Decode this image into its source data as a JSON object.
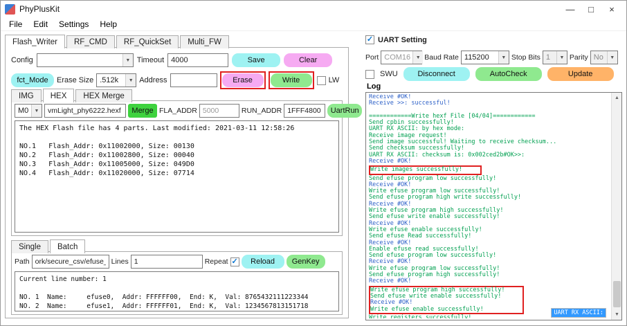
{
  "window": {
    "title": "PhyPlusKit",
    "controls": {
      "minimize": "—",
      "maximize": "□",
      "close": "×"
    }
  },
  "menu": {
    "items": [
      "File",
      "Edit",
      "Settings",
      "Help"
    ]
  },
  "main_tabs": [
    {
      "label": "Flash_Writer",
      "active": true
    },
    {
      "label": "RF_CMD",
      "active": false
    },
    {
      "label": "RF_QuickSet",
      "active": false
    },
    {
      "label": "Multi_FW",
      "active": false
    }
  ],
  "colors": {
    "button_cyan": "#9ef2f2",
    "button_pink": "#f6aaf2",
    "button_green": "#8fe98f",
    "button_green_dark": "#3ed23e",
    "button_orange": "#ffb368",
    "log_green": "#00a050",
    "log_blue": "#2b5fc7",
    "highlight_red": "#e02020",
    "selection_blue": "#3399ff"
  },
  "flash_writer": {
    "config_label": "Config",
    "config_value": "",
    "timeout_label": "Timeout",
    "timeout_value": "4000",
    "save_button": "Save",
    "clear_button": "Clear",
    "fct_mode_button": "fct_Mode",
    "erase_size_label": "Erase Size",
    "erase_size_value": ".512k",
    "address_label": "Address",
    "address_value": "",
    "erase_button": "Erase",
    "write_button": "Write",
    "lw_label": "LW",
    "lw_checked": false,
    "hex_tabs": [
      {
        "label": "IMG",
        "active": false
      },
      {
        "label": "HEX",
        "active": true
      },
      {
        "label": "HEX Merge",
        "active": false
      }
    ],
    "hex": {
      "mcu_value": "M0",
      "file_value": "vmLight_phy6222.hexf",
      "merge_button": "Merge",
      "fla_addr_label": "FLA_ADDR",
      "fla_addr_value": "5000",
      "run_addr_label": "RUN_ADDR",
      "run_addr_value": "1FFF4800",
      "uartrun_button": "UartRun",
      "info_lines": [
        "The HEX Flash file has 4 parts. Last modified: 2021-03-11 12:58:26",
        "",
        "NO.1   Flash_Addr: 0x11002000, Size: 00130",
        "NO.2   Flash_Addr: 0x11002800, Size: 00040",
        "NO.3   Flash_Addr: 0x11005000, Size: 049D0",
        "NO.4   Flash_Addr: 0x11020000, Size: 07714"
      ]
    },
    "batch_tabs": [
      {
        "label": "Single",
        "active": false
      },
      {
        "label": "Batch",
        "active": true
      }
    ],
    "batch": {
      "path_label": "Path",
      "path_value": "ork/secure_csv/efuse_wr.csv",
      "lines_label": "Lines",
      "lines_value": "1",
      "repeat_label": "Repeat",
      "repeat_checked": true,
      "reload_button": "Reload",
      "genkey_button": "GenKey",
      "info_lines": [
        "Current line number: 1",
        "",
        "NO. 1  Name:     efuse0,  Addr: FFFFFF00,  End: K,  Val: 8765432111223344",
        "NO. 2  Name:     efuse1,  Addr: FFFFFF01,  End: K,  Val: 1234567813151718"
      ]
    }
  },
  "uart": {
    "setting_label": "UART Setting",
    "setting_checked": true,
    "port_label": "Port",
    "port_value": "COM16",
    "baud_label": "Baud Rate",
    "baud_value": "115200",
    "stop_bits_label": "Stop Bits",
    "stop_bits_value": "1",
    "parity_label": "Parity",
    "parity_value": "No",
    "swu_label": "SWU",
    "swu_checked": false,
    "disconnect_button": "Disconnect",
    "autocheck_button": "AutoCheck",
    "update_button": "Update"
  },
  "log": {
    "label": "Log",
    "selection_text": "UART RX ASCII:",
    "segments": [
      {
        "boxed": false,
        "lines": [
          {
            "t": "Receive #OK!",
            "c": "b"
          },
          {
            "t": "Receive >>: successful!",
            "c": "b"
          },
          {
            "t": "",
            "c": "g"
          },
          {
            "t": "============Write hexf File [04/04]============",
            "c": "g"
          },
          {
            "t": "Send cpbin successfully!",
            "c": "g"
          },
          {
            "t": "UART RX ASCII: by hex mode:",
            "c": "g"
          },
          {
            "t": "Receive image request!",
            "c": "g"
          },
          {
            "t": "Send image successful! Waiting to receive checksum...",
            "c": "g"
          },
          {
            "t": "Send checksum successfully!",
            "c": "g"
          },
          {
            "t": "UART RX ASCII: checksum is: 0x002ced2b#OK>>:",
            "c": "g"
          },
          {
            "t": "Receive #OK!",
            "c": "b"
          }
        ]
      },
      {
        "boxed": true,
        "lines": [
          {
            "t": "Write images successfully!",
            "c": "g"
          }
        ]
      },
      {
        "boxed": false,
        "lines": [
          {
            "t": "Send efuse program low successfully!",
            "c": "g"
          },
          {
            "t": "Receive #OK!",
            "c": "b"
          },
          {
            "t": "Write efuse program low successfully!",
            "c": "g"
          },
          {
            "t": "Send efuse program high write successfully!",
            "c": "g"
          },
          {
            "t": "Receive #OK!",
            "c": "b"
          },
          {
            "t": "Write efuse program high successfully!",
            "c": "g"
          },
          {
            "t": "Send efuse write enable successfully!",
            "c": "g"
          },
          {
            "t": "Receive #OK!",
            "c": "b"
          },
          {
            "t": "Write efuse enable successfully!",
            "c": "g"
          },
          {
            "t": "Send efuse Read successfully!",
            "c": "g"
          },
          {
            "t": "Receive #OK!",
            "c": "b"
          },
          {
            "t": "Enable efuse read successfully!",
            "c": "g"
          },
          {
            "t": "Send efuse program low successfully!",
            "c": "g"
          },
          {
            "t": "Receive #OK!",
            "c": "b"
          },
          {
            "t": "Write efuse program low successfully!",
            "c": "g"
          },
          {
            "t": "Send efuse program high successfully!",
            "c": "g"
          },
          {
            "t": "Receive #OK!",
            "c": "b"
          }
        ]
      },
      {
        "boxed": true,
        "lines": [
          {
            "t": "Write efuse program high successfully!",
            "c": "g"
          },
          {
            "t": "Send efuse write enable successfully!",
            "c": "g"
          },
          {
            "t": "Receive #OK!",
            "c": "b"
          },
          {
            "t": "Write efuse enable successfully!",
            "c": "g"
          }
        ]
      },
      {
        "boxed": false,
        "lines": [
          {
            "t": "Write registers successfully!",
            "c": "g"
          }
        ]
      }
    ]
  }
}
